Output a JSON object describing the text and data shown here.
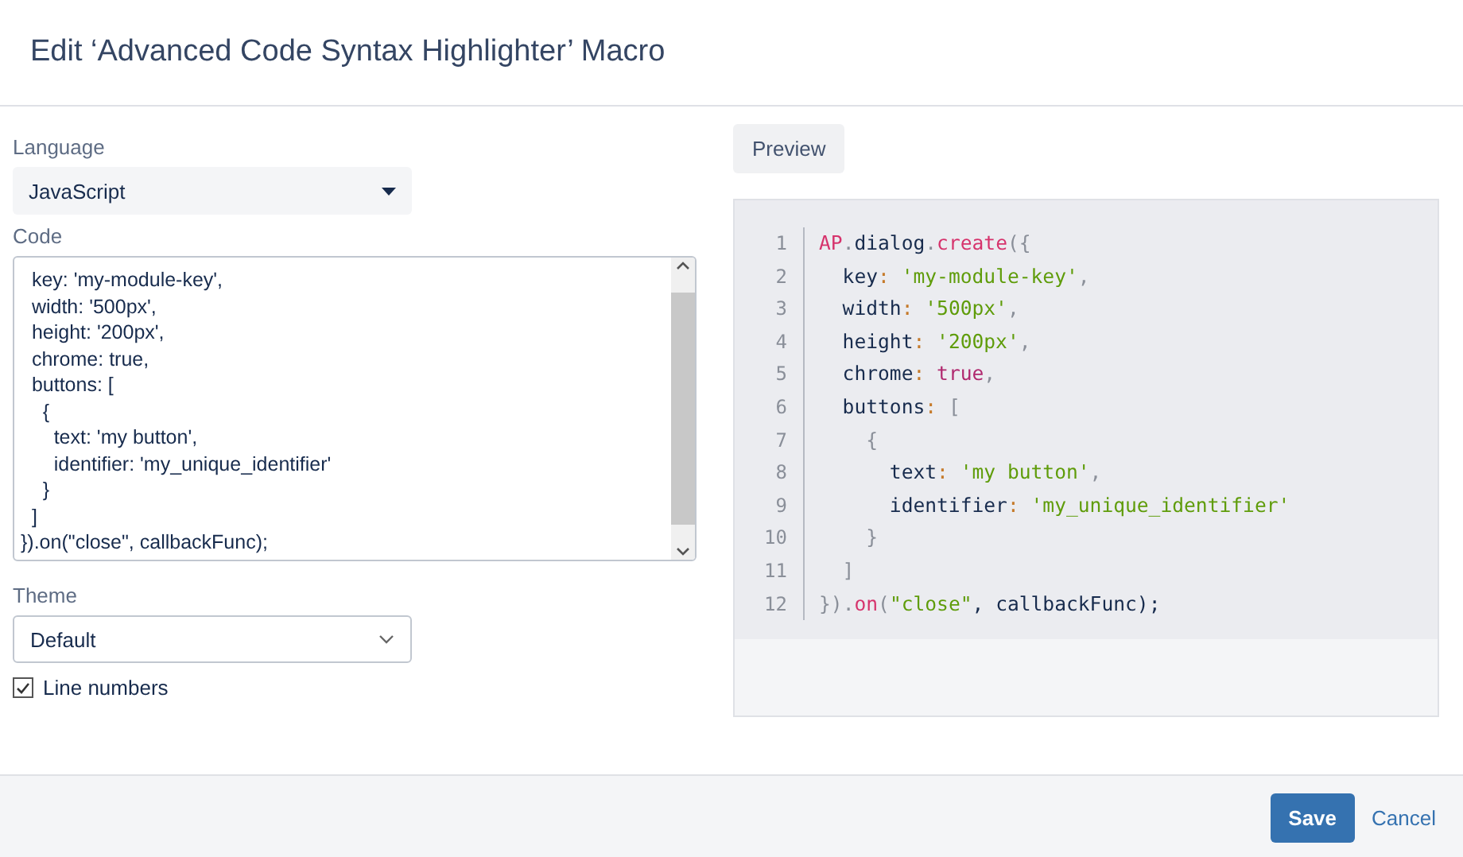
{
  "dialog": {
    "title": "Edit ‘Advanced Code Syntax Highlighter’ Macro"
  },
  "language": {
    "label": "Language",
    "value": "JavaScript"
  },
  "code": {
    "label": "Code",
    "lines": [
      "  key: 'my-module-key',",
      "  width: '500px',",
      "  height: '200px',",
      "  chrome: true,",
      "  buttons: [",
      "    {",
      "      text: 'my button',",
      "      identifier: 'my_unique_identifier'",
      "    }",
      "  ]",
      "}).on(\"close\", callbackFunc);"
    ]
  },
  "theme": {
    "label": "Theme",
    "value": "Default"
  },
  "line_numbers": {
    "label": "Line numbers",
    "checked": true
  },
  "preview": {
    "tab": "Preview",
    "lines": [
      {
        "number": "1",
        "tokens": [
          {
            "text": "AP",
            "kind": "keyword"
          },
          {
            "text": ".",
            "kind": "punct"
          },
          {
            "text": "dialog",
            "kind": "plain"
          },
          {
            "text": ".",
            "kind": "punct"
          },
          {
            "text": "create",
            "kind": "keyword"
          },
          {
            "text": "({",
            "kind": "punct"
          }
        ]
      },
      {
        "number": "2",
        "tokens": [
          {
            "text": "  key",
            "kind": "plain"
          },
          {
            "text": ":",
            "kind": "colon"
          },
          {
            "text": " 'my-module-key'",
            "kind": "string"
          },
          {
            "text": ",",
            "kind": "punct"
          }
        ]
      },
      {
        "number": "3",
        "tokens": [
          {
            "text": "  width",
            "kind": "plain"
          },
          {
            "text": ":",
            "kind": "colon"
          },
          {
            "text": " '500px'",
            "kind": "string"
          },
          {
            "text": ",",
            "kind": "punct"
          }
        ]
      },
      {
        "number": "4",
        "tokens": [
          {
            "text": "  height",
            "kind": "plain"
          },
          {
            "text": ":",
            "kind": "colon"
          },
          {
            "text": " '200px'",
            "kind": "string"
          },
          {
            "text": ",",
            "kind": "punct"
          }
        ]
      },
      {
        "number": "5",
        "tokens": [
          {
            "text": "  chrome",
            "kind": "plain"
          },
          {
            "text": ":",
            "kind": "colon"
          },
          {
            "text": " true",
            "kind": "literal"
          },
          {
            "text": ",",
            "kind": "punct"
          }
        ]
      },
      {
        "number": "6",
        "tokens": [
          {
            "text": "  buttons",
            "kind": "plain"
          },
          {
            "text": ":",
            "kind": "colon"
          },
          {
            "text": " [",
            "kind": "punct"
          }
        ]
      },
      {
        "number": "7",
        "tokens": [
          {
            "text": "    {",
            "kind": "punct"
          }
        ]
      },
      {
        "number": "8",
        "tokens": [
          {
            "text": "      text",
            "kind": "plain"
          },
          {
            "text": ":",
            "kind": "colon"
          },
          {
            "text": " 'my button'",
            "kind": "string"
          },
          {
            "text": ",",
            "kind": "punct"
          }
        ]
      },
      {
        "number": "9",
        "tokens": [
          {
            "text": "      identifier",
            "kind": "plain"
          },
          {
            "text": ":",
            "kind": "colon"
          },
          {
            "text": " 'my_unique_identifier'",
            "kind": "string"
          }
        ]
      },
      {
        "number": "10",
        "tokens": [
          {
            "text": "    }",
            "kind": "punct"
          }
        ]
      },
      {
        "number": "11",
        "tokens": [
          {
            "text": "  ]",
            "kind": "punct"
          }
        ]
      },
      {
        "number": "12",
        "tokens": [
          {
            "text": "})",
            "kind": "punct"
          },
          {
            "text": ".",
            "kind": "punct"
          },
          {
            "text": "on",
            "kind": "keyword"
          },
          {
            "text": "(",
            "kind": "punct"
          },
          {
            "text": "\"close\"",
            "kind": "string"
          },
          {
            "text": ", callbackFunc);",
            "kind": "plain"
          }
        ]
      }
    ]
  },
  "footer": {
    "save": "Save",
    "cancel": "Cancel"
  }
}
